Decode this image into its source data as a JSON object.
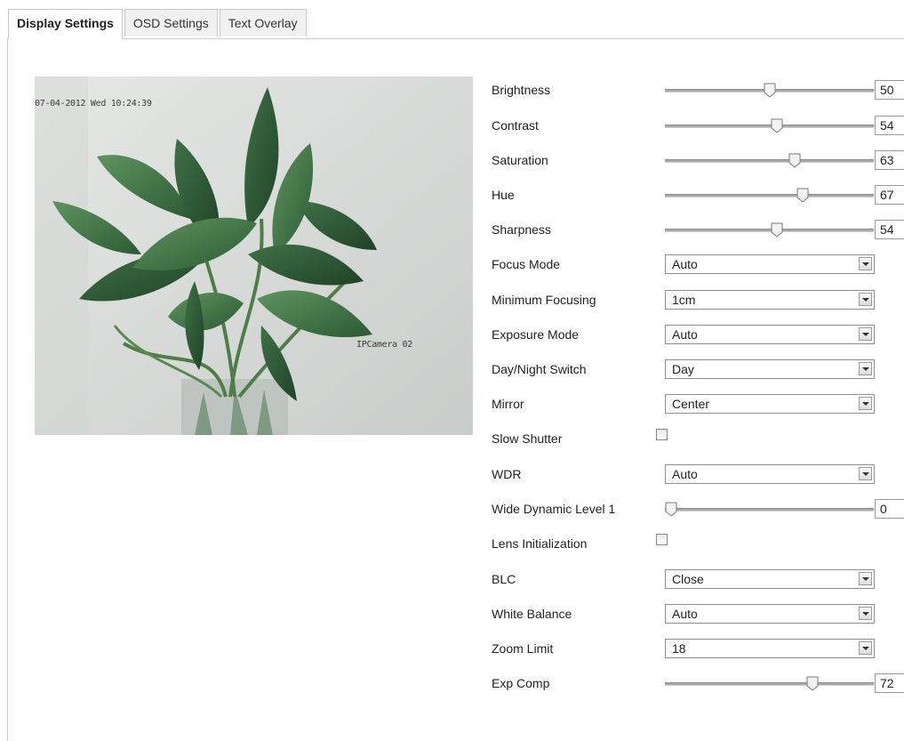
{
  "tabs": [
    {
      "label": "Display Settings",
      "active": true
    },
    {
      "label": "OSD Settings",
      "active": false
    },
    {
      "label": "Text Overlay",
      "active": false
    }
  ],
  "preview": {
    "timestamp": "07-04-2012 Wed 10:24:39",
    "camera_name": "IPCamera 02"
  },
  "settings": {
    "brightness": {
      "label": "Brightness",
      "value": "50",
      "fraction": 0.5
    },
    "contrast": {
      "label": "Contrast",
      "value": "54",
      "fraction": 0.54
    },
    "saturation": {
      "label": "Saturation",
      "value": "63",
      "fraction": 0.63
    },
    "hue": {
      "label": "Hue",
      "value": "67",
      "fraction": 0.67
    },
    "sharpness": {
      "label": "Sharpness",
      "value": "54",
      "fraction": 0.54
    },
    "focus_mode": {
      "label": "Focus Mode",
      "value": "Auto"
    },
    "minimum_focusing": {
      "label": "Minimum Focusing",
      "value": "1cm"
    },
    "exposure_mode": {
      "label": "Exposure Mode",
      "value": "Auto"
    },
    "day_night_switch": {
      "label": "Day/Night Switch",
      "value": "Day"
    },
    "mirror": {
      "label": "Mirror",
      "value": "Center"
    },
    "slow_shutter": {
      "label": "Slow Shutter",
      "checked": false
    },
    "wdr": {
      "label": "WDR",
      "value": "Auto"
    },
    "wide_dynamic_level": {
      "label": "Wide Dynamic Level 1",
      "value": "0",
      "fraction": 0.0
    },
    "lens_initialization": {
      "label": "Lens Initialization",
      "checked": false
    },
    "blc": {
      "label": "BLC",
      "value": "Close"
    },
    "white_balance": {
      "label": "White Balance",
      "value": "Auto"
    },
    "zoom_limit": {
      "label": "Zoom Limit",
      "value": "18"
    },
    "exp_comp": {
      "label": "Exp Comp",
      "value": "72",
      "fraction": 0.72
    }
  }
}
